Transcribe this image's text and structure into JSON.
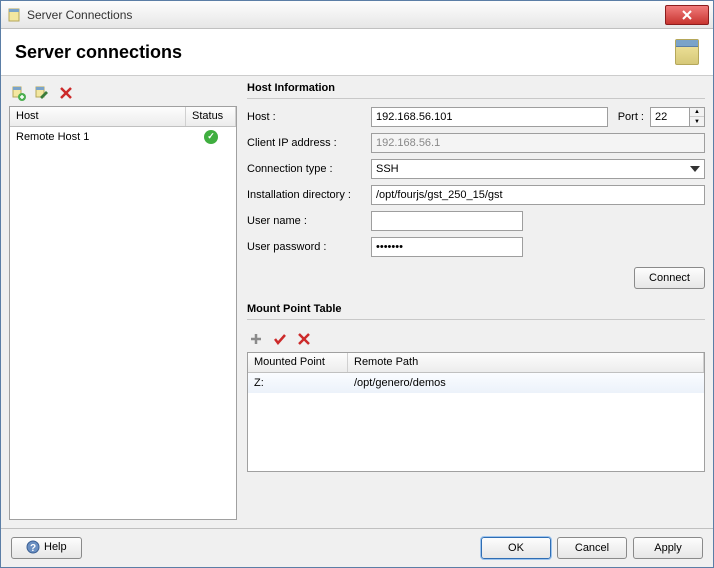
{
  "window": {
    "title": "Server Connections"
  },
  "header": {
    "title": "Server connections"
  },
  "left": {
    "cols": {
      "host": "Host",
      "status": "Status"
    },
    "rows": [
      {
        "name": "Remote Host 1",
        "status": "ok"
      }
    ]
  },
  "hostinfo": {
    "section_title": "Host Information",
    "labels": {
      "host": "Host :",
      "port": "Port :",
      "client_ip": "Client IP address :",
      "conn_type": "Connection type :",
      "install_dir": "Installation directory :",
      "user": "User name :",
      "pass": "User password :"
    },
    "values": {
      "host": "192.168.56.101",
      "port": "22",
      "client_ip": "192.168.56.1",
      "conn_type": "SSH",
      "install_dir": "/opt/fourjs/gst_250_15/gst",
      "user": "",
      "pass": "•••••••"
    },
    "connect_label": "Connect"
  },
  "mount": {
    "section_title": "Mount Point Table",
    "cols": {
      "mp": "Mounted Point",
      "rp": "Remote Path"
    },
    "rows": [
      {
        "mp": "Z:",
        "rp": "/opt/genero/demos"
      }
    ]
  },
  "footer": {
    "help": "Help",
    "ok": "OK",
    "cancel": "Cancel",
    "apply": "Apply"
  }
}
